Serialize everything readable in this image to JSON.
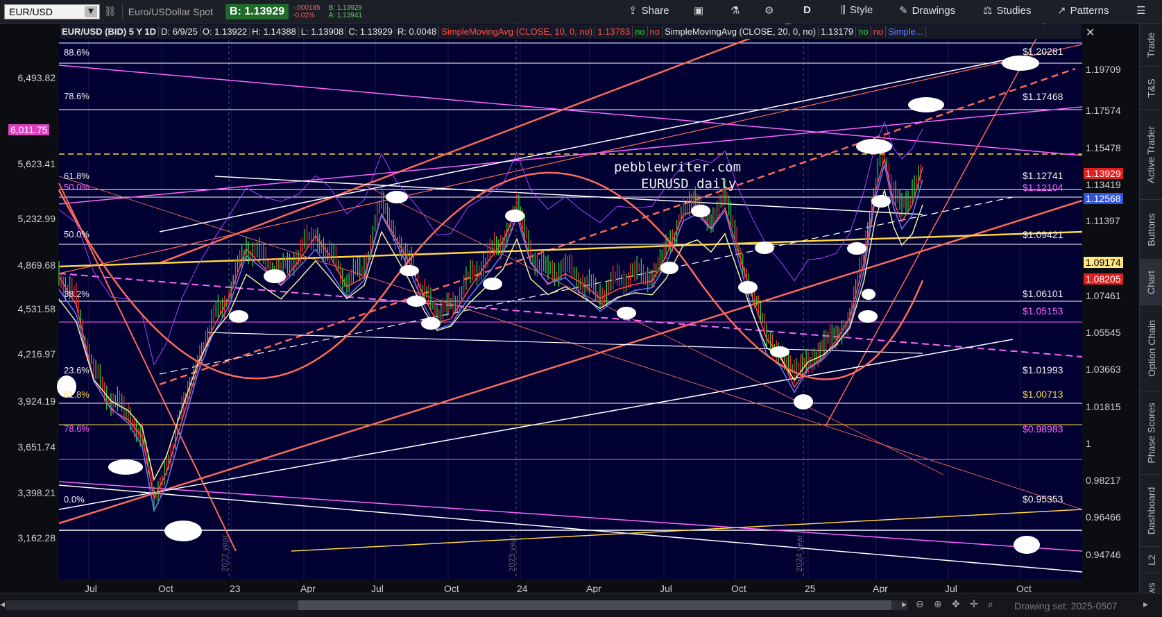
{
  "toolbar": {
    "symbol": "EUR/USD",
    "description": "Euro/USDollar Spot",
    "last_price": "B: 1.13929",
    "change": "-.000185",
    "change_pct": "-0.02%",
    "bid": "B: 1.13929",
    "ask": "A: 1.13941",
    "share_label": "Share",
    "period_label": "D",
    "style_label": "Style",
    "drawings_label": "Drawings",
    "studies_label": "Studies",
    "patterns_label": "Patterns"
  },
  "legend": {
    "symbol": "EUR/USD (BID) 5 Y 1D",
    "date": "D: 6/9/25",
    "open": "O: 1.13922",
    "high": "H: 1.14388",
    "low": "L: 1.13908",
    "close": "C: 1.13929",
    "range": "R: 0.0048",
    "sma1_name": "SimpleMovingAvg (CLOSE, 10, 0, no)",
    "sma1_value": "1.13783",
    "sma2_name": "SimpleMovingAvg (CLOSE, 20, 0, no)",
    "sma2_value": "1.13179",
    "sma3_name": "Simple...",
    "no_label": "no"
  },
  "annotation": {
    "line1": "pebblewriter.com",
    "line2": "EURUSD daily"
  },
  "fib_labels": [
    "88.6%",
    "78.6%",
    "61.8%",
    "50.0%",
    "50.0%",
    "38.2%",
    "23.6%",
    "61.8%",
    "78.6%",
    "0.0%"
  ],
  "levels": [
    {
      "text": "$1.20281",
      "color": "#f0f0f0"
    },
    {
      "text": "$1.17468",
      "color": "#f0f0f0"
    },
    {
      "text": "$1.12741",
      "color": "#f0f0f0"
    },
    {
      "text": "$1.12104",
      "color": "#ff66ff"
    },
    {
      "text": "$1.09421",
      "color": "#f0f0f0"
    },
    {
      "text": "$1.06101",
      "color": "#f0f0f0"
    },
    {
      "text": "$1.05153",
      "color": "#ff66ff"
    },
    {
      "text": "$1.01993",
      "color": "#f0f0f0"
    },
    {
      "text": "$1.00713",
      "color": "#ffd740"
    },
    {
      "text": "$0.98983",
      "color": "#ff66ff"
    },
    {
      "text": "$0.95353",
      "color": "#f0f0f0"
    }
  ],
  "y_left": [
    "6,493.82",
    "6,011.75",
    "5,623.41",
    "5,232.99",
    "4,869.68",
    "4,531.58",
    "4,216.97",
    "3,924.19",
    "3,651.74",
    "3,398.21",
    "3,162.28"
  ],
  "y_right": [
    "1.19709",
    "1.17574",
    "1.15478",
    "1.13419",
    "1.11397",
    "1.07461",
    "1.05545",
    "1.03663",
    "1.01815",
    "1",
    "0.98217",
    "0.96466",
    "0.94746"
  ],
  "y_badges": [
    {
      "text": "1.13929",
      "bg": "#e02020",
      "fg": "#ffffff"
    },
    {
      "text": "1.12568",
      "bg": "#3355dd",
      "fg": "#ffffff"
    },
    {
      "text": "1.09174",
      "bg": "#ffe680",
      "fg": "#000000"
    },
    {
      "text": "1.08205",
      "bg": "#e02020",
      "fg": "#ffffff"
    }
  ],
  "left_badge": {
    "text": "6,011.75",
    "bg": "#e040c0",
    "fg": "#ffffff"
  },
  "x_labels": [
    "Jul",
    "Oct",
    "23",
    "Apr",
    "Jul",
    "Oct",
    "24",
    "Apr",
    "Jul",
    "Oct",
    "25",
    "Apr",
    "Jul",
    "Oct"
  ],
  "year_labels": [
    "2022 year",
    "2023 year",
    "2024 year"
  ],
  "rail_tabs": [
    "Trade",
    "T&S",
    "Active Trader",
    "Buttons",
    "Chart",
    "Option Chain",
    "Phase Scores",
    "Dashboard",
    "L2",
    "News"
  ],
  "status": {
    "drawing_set": "Drawing set: 2025-0507"
  },
  "colors": {
    "background": "#000033",
    "up_candle": "#2ee02e",
    "down_candle": "#ff3030",
    "sma10": "#ff4d4d",
    "sma20": "#6b7bff",
    "sma50": "#f5f0a0",
    "overlay": "#b040ff"
  }
}
